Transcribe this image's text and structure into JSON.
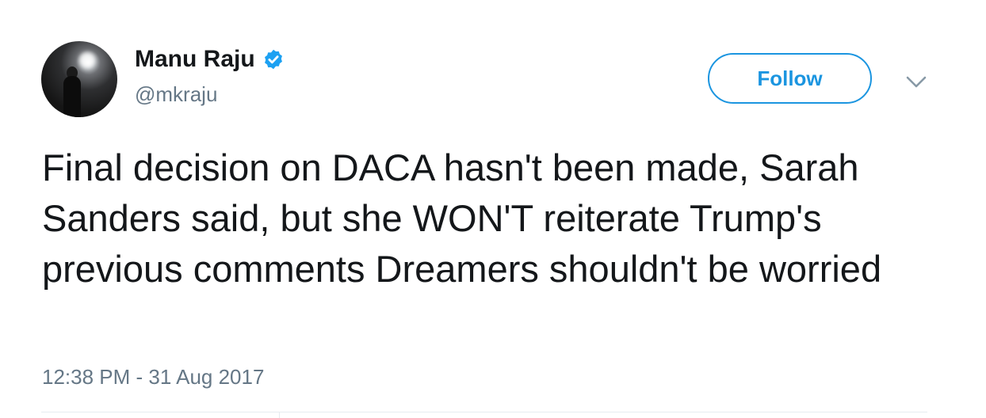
{
  "author": {
    "name": "Manu Raju",
    "handle": "@mkraju",
    "verified_icon": "verified-badge-icon",
    "avatar_icon": "profile-photo"
  },
  "actions": {
    "follow_label": "Follow",
    "menu_icon": "chevron-down-icon"
  },
  "tweet": {
    "text": "Final decision on DACA hasn't been made, Sarah Sanders said, but she WON'T reiterate Trump's previous comments Dreamers shouldn't be worried",
    "timestamp": "12:38 PM - 31 Aug 2017"
  },
  "colors": {
    "accent": "#1b95e0",
    "verified": "#1da1f2",
    "text_primary": "#14171a",
    "text_secondary": "#657786",
    "divider": "#e6ecf0"
  }
}
